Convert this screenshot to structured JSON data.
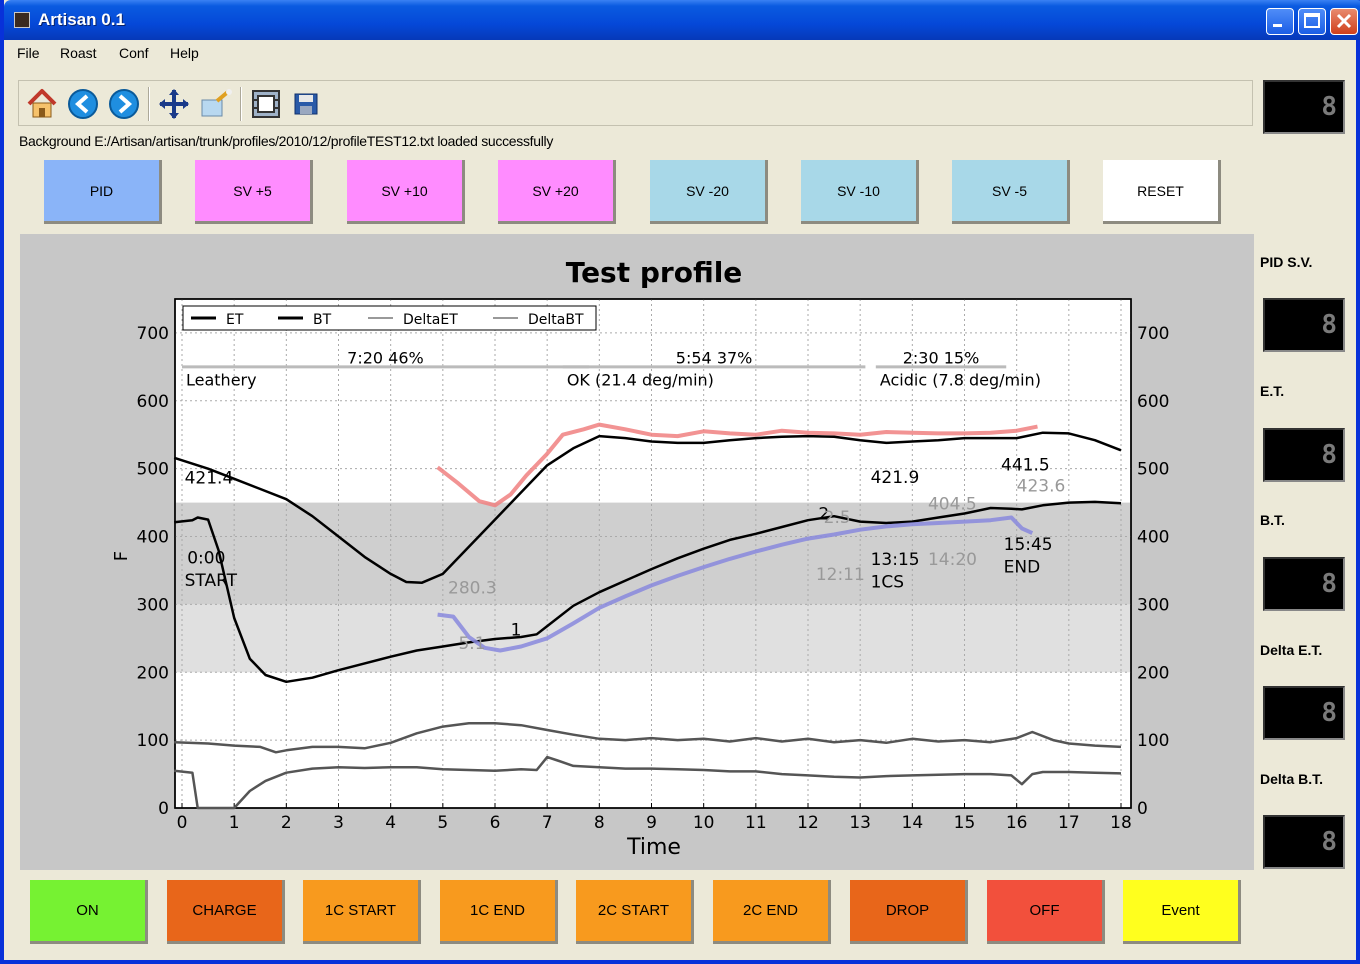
{
  "window": {
    "title": "Artisan 0.1"
  },
  "menu": [
    "File",
    "Roast",
    "Conf",
    "Help"
  ],
  "toolbar": {
    "icons": [
      "home-icon",
      "back-icon",
      "forward-icon",
      "pan-icon",
      "zoom-icon",
      "configure-subplots-icon",
      "save-icon"
    ]
  },
  "status": {
    "message": "Background E:/Artisan/artisan/trunk/profiles/2010/12/profileTEST12.txt loaded successfully"
  },
  "pid_buttons": [
    {
      "label": "PID",
      "color": "#8ab4f8"
    },
    {
      "label": "SV +5",
      "color": "#ff8cff"
    },
    {
      "label": "SV +10",
      "color": "#ff8cff"
    },
    {
      "label": "SV +20",
      "color": "#ff8cff"
    },
    {
      "label": "SV -20",
      "color": "#a8d8e8"
    },
    {
      "label": "SV -10",
      "color": "#a8d8e8"
    },
    {
      "label": "SV -5",
      "color": "#a8d8e8"
    },
    {
      "label": "RESET",
      "color": "#ffffff"
    }
  ],
  "side_panel": [
    {
      "label": "",
      "value": "8"
    },
    {
      "label": "PID S.V.",
      "value": "8"
    },
    {
      "label": "E.T.",
      "value": "8"
    },
    {
      "label": "B.T.",
      "value": "8"
    },
    {
      "label": "Delta E.T.",
      "value": "8"
    },
    {
      "label": "Delta B.T.",
      "value": "8"
    }
  ],
  "event_buttons": [
    {
      "label": "ON",
      "color": "#76f232"
    },
    {
      "label": "CHARGE",
      "color": "#e8661a"
    },
    {
      "label": "1C START",
      "color": "#f89a1e"
    },
    {
      "label": "1C END",
      "color": "#f89a1e"
    },
    {
      "label": "2C START",
      "color": "#f89a1e"
    },
    {
      "label": "2C END",
      "color": "#f89a1e"
    },
    {
      "label": "DROP",
      "color": "#e8661a"
    },
    {
      "label": "OFF",
      "color": "#f2503c"
    },
    {
      "label": "Event",
      "color": "#ffff1e"
    }
  ],
  "chart_data": {
    "type": "line",
    "title": "Test profile",
    "xlabel": "Time",
    "ylabel": "F",
    "xlim": [
      0,
      18
    ],
    "ylim": [
      0,
      750
    ],
    "xticks": [
      0,
      1,
      2,
      3,
      4,
      5,
      6,
      7,
      8,
      9,
      10,
      11,
      12,
      13,
      14,
      15,
      16,
      17,
      18
    ],
    "yticks": [
      0,
      100,
      200,
      300,
      400,
      500,
      600,
      700
    ],
    "grid": true,
    "legend": [
      "ET",
      "BT",
      "DeltaET",
      "DeltaBT"
    ],
    "legend_position": "top-left",
    "background_bands": [
      {
        "y0": 200,
        "y1": 300,
        "color": "#e0e0e0"
      },
      {
        "y0": 300,
        "y1": 450,
        "color": "#cfcfcf"
      }
    ],
    "phases": [
      {
        "label": "7:20 46%",
        "sub": "Leathery",
        "x0": 0,
        "x1": 7.8
      },
      {
        "label": "5:54 37%",
        "sub": "OK  (21.4 deg/min)",
        "x0": 7.3,
        "x1": 13.1
      },
      {
        "label": "2:30 15%",
        "sub": "Acidic  (7.8 deg/min)",
        "x0": 13.3,
        "x1": 15.8
      }
    ],
    "series": [
      {
        "name": "ET",
        "color": "#000000",
        "x": [
          -0.15,
          0.5,
          1,
          1.5,
          2,
          2.5,
          3,
          3.5,
          4,
          4.3,
          4.6,
          5,
          5.5,
          6,
          6.5,
          7,
          7.5,
          8,
          8.5,
          9,
          9.5,
          10,
          10.5,
          11,
          11.5,
          12,
          12.5,
          13,
          13.5,
          14,
          14.5,
          15,
          15.5,
          16,
          16.5,
          17,
          17.5,
          18
        ],
        "y": [
          516,
          500,
          485,
          470,
          455,
          430,
          400,
          370,
          345,
          333,
          332,
          345,
          385,
          425,
          465,
          505,
          530,
          548,
          545,
          540,
          538,
          538,
          542,
          545,
          547,
          548,
          547,
          542,
          538,
          540,
          542,
          545,
          545,
          545,
          553,
          552,
          542,
          527
        ]
      },
      {
        "name": "BT",
        "color": "#000000",
        "x": [
          -0.15,
          0.2,
          0.3,
          0.5,
          0.7,
          1,
          1.3,
          1.6,
          2,
          2.5,
          3,
          3.5,
          4,
          4.5,
          5,
          5.5,
          6,
          6.5,
          6.8,
          7,
          7.5,
          8,
          8.5,
          9,
          9.5,
          10,
          10.5,
          11,
          11.5,
          12,
          12.5,
          13,
          13.5,
          14,
          14.5,
          15,
          15.5,
          15.9,
          16.1,
          16.5,
          17,
          17.5,
          18
        ],
        "y": [
          421,
          424,
          428,
          425,
          380,
          280,
          220,
          196,
          186,
          192,
          203,
          213,
          223,
          232,
          238,
          244,
          249,
          252,
          256,
          268,
          298,
          318,
          335,
          352,
          368,
          382,
          395,
          404,
          414,
          424,
          430,
          422,
          420,
          422,
          428,
          434,
          442,
          441,
          440,
          446,
          450,
          451,
          449
        ]
      },
      {
        "name": "BT (background)",
        "color": "#8888dd",
        "width": 4,
        "x": [
          4.9,
          5.2,
          5.5,
          5.8,
          6.1,
          6.5,
          7,
          7.5,
          8,
          8.5,
          9,
          9.5,
          10,
          10.5,
          11,
          11.5,
          12,
          12.5,
          13,
          13.5,
          14,
          14.5,
          15,
          15.5,
          15.9,
          16.1,
          16.3
        ],
        "y": [
          285,
          282,
          252,
          236,
          232,
          238,
          250,
          272,
          295,
          312,
          328,
          342,
          355,
          367,
          378,
          388,
          397,
          403,
          410,
          415,
          418,
          420,
          422,
          424,
          428,
          412,
          405
        ]
      },
      {
        "name": "ET (background)",
        "color": "#f08080",
        "width": 4,
        "x": [
          4.9,
          5.3,
          5.7,
          6,
          6.3,
          6.6,
          7,
          7.3,
          7.7,
          8,
          8.5,
          9,
          9.5,
          10,
          10.5,
          11,
          11.5,
          12,
          12.5,
          13,
          13.5,
          14,
          14.5,
          15,
          15.5,
          16,
          16.4
        ],
        "y": [
          502,
          478,
          452,
          446,
          462,
          490,
          522,
          550,
          558,
          565,
          558,
          550,
          548,
          555,
          552,
          550,
          556,
          553,
          552,
          550,
          554,
          553,
          552,
          552,
          553,
          556,
          562
        ]
      },
      {
        "name": "DeltaET",
        "color": "#555555",
        "x": [
          -0.15,
          0.5,
          1,
          1.5,
          1.8,
          2,
          2.5,
          3,
          3.5,
          4,
          4.5,
          5,
          5.5,
          6,
          6.5,
          7,
          7.5,
          8,
          8.5,
          9,
          9.5,
          10,
          10.5,
          11,
          11.5,
          12,
          12.5,
          13,
          13.5,
          14,
          14.5,
          15,
          15.5,
          16,
          16.3,
          16.7,
          17,
          17.5,
          18
        ],
        "y": [
          97,
          95,
          92,
          90,
          82,
          85,
          90,
          90,
          88,
          96,
          110,
          120,
          125,
          125,
          122,
          115,
          108,
          102,
          100,
          103,
          100,
          102,
          98,
          103,
          98,
          102,
          97,
          100,
          96,
          102,
          98,
          100,
          97,
          103,
          112,
          100,
          95,
          92,
          90
        ]
      },
      {
        "name": "DeltaBT",
        "color": "#555555",
        "x": [
          -0.15,
          0.2,
          0.3,
          0.5,
          1,
          1.3,
          1.6,
          2,
          2.5,
          3,
          3.5,
          4,
          4.5,
          5,
          5.5,
          6,
          6.5,
          6.8,
          7,
          7.2,
          7.5,
          8,
          8.5,
          9,
          9.5,
          10,
          10.5,
          11,
          11.5,
          12,
          12.5,
          13,
          13.5,
          14,
          14.5,
          15,
          15.5,
          15.9,
          16.1,
          16.3,
          16.5,
          17,
          17.5,
          18
        ],
        "y": [
          55,
          52,
          0,
          0,
          0,
          25,
          40,
          52,
          58,
          60,
          59,
          60,
          60,
          57,
          56,
          55,
          57,
          56,
          75,
          70,
          62,
          60,
          58,
          58,
          57,
          56,
          54,
          54,
          50,
          48,
          46,
          45,
          47,
          48,
          49,
          50,
          50,
          48,
          35,
          50,
          53,
          53,
          52,
          51
        ]
      }
    ],
    "annotations": [
      {
        "text": "421.4",
        "x": 0.05,
        "y": 478,
        "color": "#000"
      },
      {
        "text": "0:00",
        "x": 0.1,
        "y": 360,
        "color": "#000"
      },
      {
        "text": "START",
        "x": 0.05,
        "y": 327,
        "color": "#000"
      },
      {
        "text": "280.3",
        "x": 5.1,
        "y": 316,
        "color": "#999"
      },
      {
        "text": "5.1",
        "x": 5.3,
        "y": 234,
        "color": "#999"
      },
      {
        "text": "1",
        "x": 6.3,
        "y": 254,
        "color": "#000"
      },
      {
        "text": "2",
        "x": 12.2,
        "y": 425,
        "color": "#000"
      },
      {
        "text": "2.5",
        "x": 12.3,
        "y": 420,
        "color": "#999"
      },
      {
        "text": "12:11",
        "x": 12.15,
        "y": 336,
        "color": "#999"
      },
      {
        "text": "421.9",
        "x": 13.2,
        "y": 479,
        "color": "#000"
      },
      {
        "text": "404.5",
        "x": 14.3,
        "y": 440,
        "color": "#999"
      },
      {
        "text": "13:15",
        "x": 13.2,
        "y": 358,
        "color": "#000"
      },
      {
        "text": "1CS",
        "x": 13.2,
        "y": 325,
        "color": "#000"
      },
      {
        "text": "14:20",
        "x": 14.3,
        "y": 358,
        "color": "#999"
      },
      {
        "text": "441.5",
        "x": 15.7,
        "y": 497,
        "color": "#000"
      },
      {
        "text": "423.6",
        "x": 16.0,
        "y": 466,
        "color": "#999"
      },
      {
        "text": "15:45",
        "x": 15.75,
        "y": 380,
        "color": "#000"
      },
      {
        "text": "END",
        "x": 15.75,
        "y": 347,
        "color": "#000"
      }
    ]
  }
}
